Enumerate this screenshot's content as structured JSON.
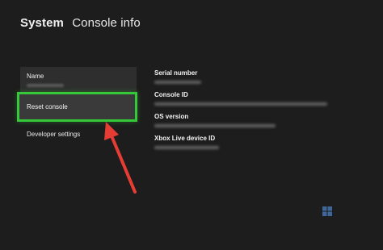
{
  "header": {
    "title": "System",
    "subtitle": "Console info"
  },
  "menu": {
    "name_label": "Name",
    "reset_label": "Reset console",
    "developer_label": "Developer settings"
  },
  "info": {
    "serial_label": "Serial number",
    "console_id_label": "Console ID",
    "os_version_label": "OS version",
    "xbox_live_label": "Xbox Live device ID"
  },
  "colors": {
    "focus": "#35c93a",
    "arrow": "#e53d33",
    "background": "#1d1d1d"
  }
}
